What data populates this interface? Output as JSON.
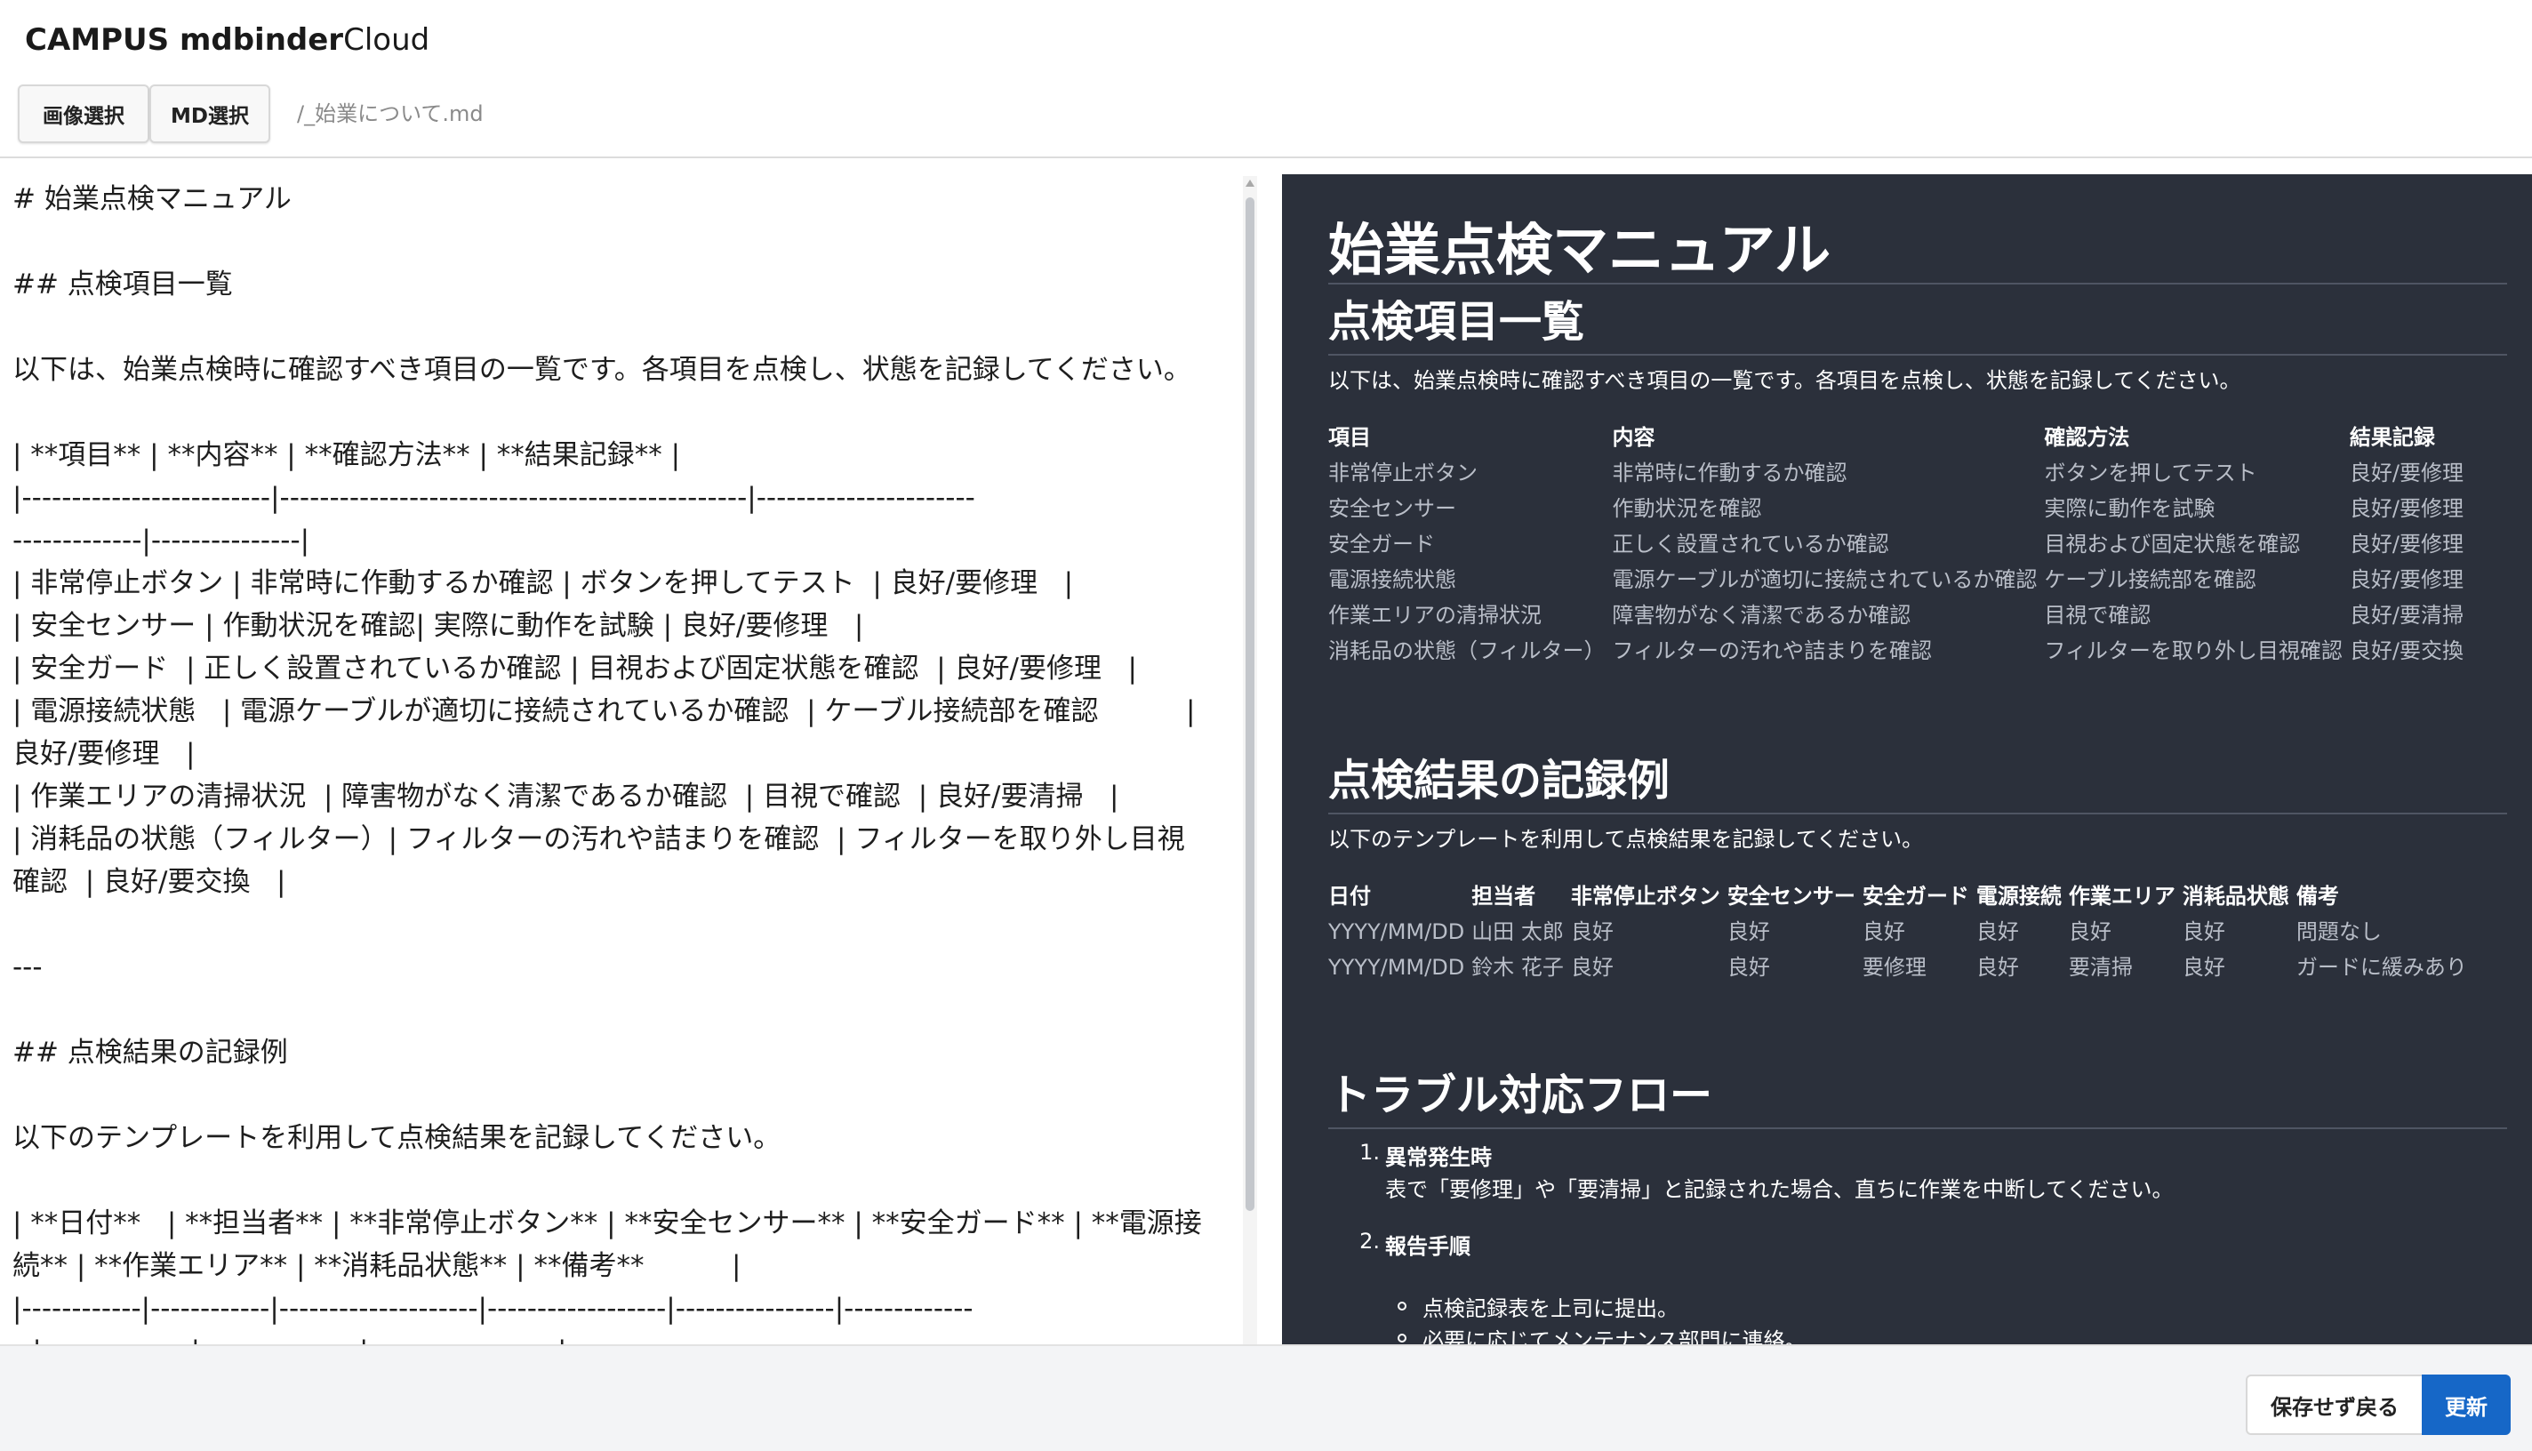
{
  "header": {
    "app_name_bold": "CAMPUS mdbinder",
    "app_name_light": "Cloud",
    "image_select_label": "画像選択",
    "md_select_label": "MD選択",
    "file_path": "/_始業について.md"
  },
  "editor": {
    "lines": [
      "# 始業点検マニュアル",
      "",
      "## 点検項目一覧",
      "",
      "以下は、始業点検時に確認すべき項目の一覧です。各項目を点検し、状態を記録してください。",
      "",
      "| **項目** | **内容** | **確認方法** | **結果記録** |",
      "|-------------------------|-----------------------------------------------|----------------------",
      "-------------|---------------|",
      "| 非常停止ボタン | 非常時に作動するか確認 | ボタンを押してテスト  | 良好/要修理   |",
      "| 安全センサー | 作動状況を確認| 実際に動作を試験 | 良好/要修理   |",
      "| 安全ガード  | 正しく設置されているか確認 | 目視および固定状態を確認  | 良好/要修理   |",
      "| 電源接続状態   | 電源ケーブルが適切に接続されているか確認  | ケーブル接続部を確認          |",
      "良好/要修理   |",
      "| 作業エリアの清掃状況  | 障害物がなく清潔であるか確認  | 目視で確認  | 良好/要清掃   |",
      "| 消耗品の状態（フィルター）| フィルターの汚れや詰まりを確認  | フィルターを取り外し目視",
      "確認  | 良好/要交換   |",
      "",
      "---",
      "",
      "## 点検結果の記録例",
      "",
      "以下のテンプレートを利用して点検結果を記録してください。",
      "",
      "| **日付**   | **担当者** | **非常停止ボタン** | **安全センサー** | **安全ガード** | **電源接",
      "続** | **作業エリア** | **消耗品状態** | **備考**          |",
      "|------------|------------|--------------------|------------------|----------------|-------------",
      "--|---------------|----------------|-------------------|"
    ]
  },
  "preview": {
    "h1": "始業点検マニュアル",
    "section1": {
      "title": "点検項目一覧",
      "desc": "以下は、始業点検時に確認すべき項目の一覧です。各項目を点検し、状態を記録してください。",
      "headers": [
        "項目",
        "内容",
        "確認方法",
        "結果記録"
      ],
      "rows": [
        [
          "非常停止ボタン",
          "非常時に作動するか確認",
          "ボタンを押してテスト",
          "良好/要修理"
        ],
        [
          "安全センサー",
          "作動状況を確認",
          "実際に動作を試験",
          "良好/要修理"
        ],
        [
          "安全ガード",
          "正しく設置されているか確認",
          "目視および固定状態を確認",
          "良好/要修理"
        ],
        [
          "電源接続状態",
          "電源ケーブルが適切に接続されているか確認",
          "ケーブル接続部を確認",
          "良好/要修理"
        ],
        [
          "作業エリアの清掃状況",
          "障害物がなく清潔であるか確認",
          "目視で確認",
          "良好/要清掃"
        ],
        [
          "消耗品の状態（フィルター）",
          "フィルターの汚れや詰まりを確認",
          "フィルターを取り外し目視確認",
          "良好/要交換"
        ]
      ]
    },
    "section2": {
      "title": "点検結果の記録例",
      "desc": "以下のテンプレートを利用して点検結果を記録してください。",
      "headers": [
        "日付",
        "担当者",
        "非常停止ボタン",
        "安全センサー",
        "安全ガード",
        "電源接続",
        "作業エリア",
        "消耗品状態",
        "備考"
      ],
      "rows": [
        [
          "YYYY/MM/DD",
          "山田 太郎",
          "良好",
          "良好",
          "良好",
          "良好",
          "良好",
          "良好",
          "問題なし"
        ],
        [
          "YYYY/MM/DD",
          "鈴木 花子",
          "良好",
          "良好",
          "要修理",
          "良好",
          "要清掃",
          "良好",
          "ガードに緩みあり"
        ]
      ]
    },
    "section3": {
      "title": "トラブル対応フロー",
      "steps": [
        {
          "num": "1.",
          "title": "異常発生時",
          "desc": "表で「要修理」や「要清掃」と記録された場合、直ちに作業を中断してください。"
        },
        {
          "num": "2.",
          "title": "報告手順"
        }
      ],
      "bullets": [
        "点検記録表を上司に提出。",
        "必要に応じてメンテナンス部門に連絡。"
      ]
    }
  },
  "footer": {
    "back_label": "保存せず戻る",
    "update_label": "更新"
  },
  "colors": {
    "preview_bg": "#2b303b",
    "primary_button": "#1667c7"
  }
}
